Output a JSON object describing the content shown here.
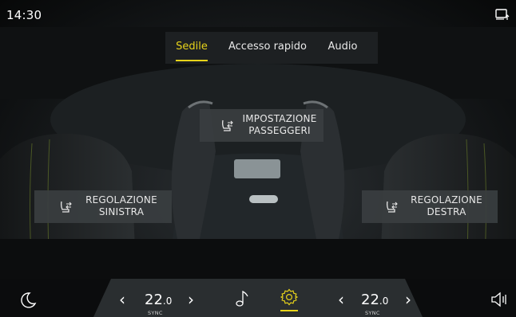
{
  "status": {
    "time": "14:30",
    "screen_icon": "screen-mirror-icon"
  },
  "tabs": [
    {
      "label": "Sedile",
      "active": true
    },
    {
      "label": "Accesso rapido",
      "active": false
    },
    {
      "label": "Audio",
      "active": false
    }
  ],
  "seat_buttons": {
    "passengers": {
      "line1": "IMPOSTAZIONE",
      "line2": "PASSEGGERI",
      "icon": "seat-adjust-icon"
    },
    "left": {
      "line1": "REGOLAZIONE",
      "line2": "SINISTRA",
      "icon": "seat-adjust-icon"
    },
    "right": {
      "line1": "REGOLAZIONE",
      "line2": "DESTRA",
      "icon": "seat-adjust-icon"
    }
  },
  "bottom_bar": {
    "left_temp": {
      "value": "22",
      "decimal": ".0",
      "sub": "SYNC"
    },
    "right_temp": {
      "value": "22",
      "decimal": ".0",
      "sub": "SYNC"
    },
    "icons": [
      "night-mode-icon",
      "music-note-icon",
      "settings-gear-icon",
      "volume-icon"
    ]
  },
  "colors": {
    "accent": "#e7d31a",
    "panel": "#1d2022",
    "button": "#3a3e40"
  }
}
